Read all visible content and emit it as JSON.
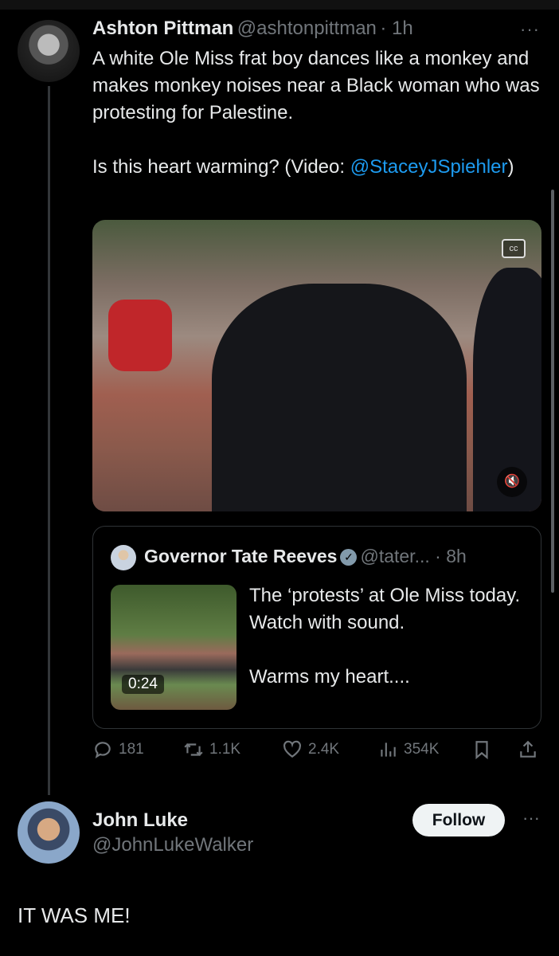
{
  "tweet": {
    "name": "Ashton Pittman",
    "handle": "@ashtonpittman",
    "time": "· 1h",
    "more": "···",
    "text": "A white Ole Miss frat boy dances like a monkey and makes monkey noises near a Black woman who was protesting for Palestine.\n\nIs this heart warming? (Video: ",
    "mention": "@StaceyJSpiehler",
    "text_end": ")",
    "video": {
      "cc_label": "cc",
      "mute_icon": "speaker-muted-icon"
    }
  },
  "quote": {
    "name": "Governor Tate Reeves",
    "handle": "@tater...",
    "time": "· 8h",
    "verified": true,
    "text": "The ‘protests’ at Ole Miss today. Watch with sound.\n\nWarms my heart....",
    "duration": "0:24"
  },
  "actions": {
    "replies": "181",
    "reposts": "1.1K",
    "likes": "2.4K",
    "views": "354K"
  },
  "reply": {
    "name": "John Luke",
    "handle": "@JohnLukeWalker",
    "follow": "Follow",
    "more": "···",
    "text": "IT WAS ME!"
  },
  "colors": {
    "link": "#1d9bf0",
    "background": "#000000",
    "muted": "#71767b"
  }
}
